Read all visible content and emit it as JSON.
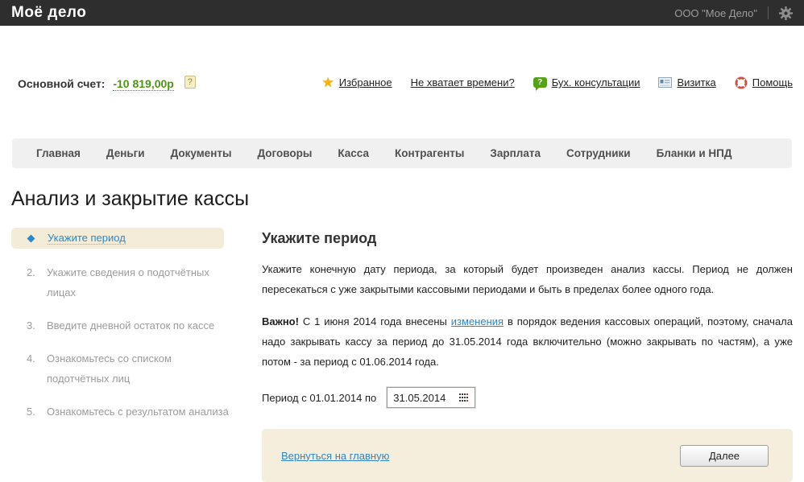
{
  "topbar": {
    "logo": "Моё дело",
    "company": "ООО \"Мое Дело\""
  },
  "account": {
    "label": "Основной счет:",
    "value": "-10 819,00р",
    "help_badge": "?"
  },
  "quick_links": [
    {
      "icon": "star-icon",
      "label": "Избранное"
    },
    {
      "icon": null,
      "label": "Не хватает времени?"
    },
    {
      "icon": "chat-question-icon",
      "badge": "?",
      "label": "Бух. консультации"
    },
    {
      "icon": "business-card-icon",
      "label": "Визитка"
    },
    {
      "icon": "lifebuoy-icon",
      "label": "Помощь"
    }
  ],
  "nav": {
    "items": [
      "Главная",
      "Деньги",
      "Документы",
      "Договоры",
      "Касса",
      "Контрагенты",
      "Зарплата",
      "Сотрудники",
      "Бланки и НПД"
    ]
  },
  "page": {
    "title": "Анализ и закрытие кассы"
  },
  "steps": {
    "active_label": "Укажите период",
    "items": [
      {
        "num": "2.",
        "label": "Укажите сведения о подотчётных лицах"
      },
      {
        "num": "3.",
        "label": "Введите дневной остаток по кассе"
      },
      {
        "num": "4.",
        "label": "Ознакомьтесь со списком подотчётных лиц"
      },
      {
        "num": "5.",
        "label": "Ознакомьтесь с результатом анализа"
      }
    ]
  },
  "content": {
    "heading": "Укажите период",
    "para1": "Укажите конечную дату периода, за который будет произведен анализ кассы. Период не должен пересекаться с уже закрытыми кассовыми периодами и быть в пределах более одного года.",
    "important_label": "Важно!",
    "para2_before_link": " С 1 июня 2014 года внесены ",
    "para2_link": "изменения",
    "para2_after_link": " в порядок ведения кассовых операций, поэтому, сначала надо закрывать кассу за период до 31.05.2014 года включительно (можно закрывать по частям), а уже потом - за период с 01.06.2014 года.",
    "period_label": "Период с 01.01.2014 по",
    "date_value": "31.05.2014"
  },
  "footer": {
    "back_link": "Вернуться на главную",
    "next_button": "Далее"
  },
  "colors": {
    "topbar_bg": "#2e2e2e",
    "balance_green": "#4e9416",
    "link_blue": "#2f86c4",
    "panel_beige": "#f5eedd",
    "active_step_bg": "#f3ecd9",
    "nav_bg": "#f0f0f0",
    "star_yellow": "#f6b312",
    "consult_green": "#55a117",
    "lifebuoy_red": "#cf4c3f"
  }
}
